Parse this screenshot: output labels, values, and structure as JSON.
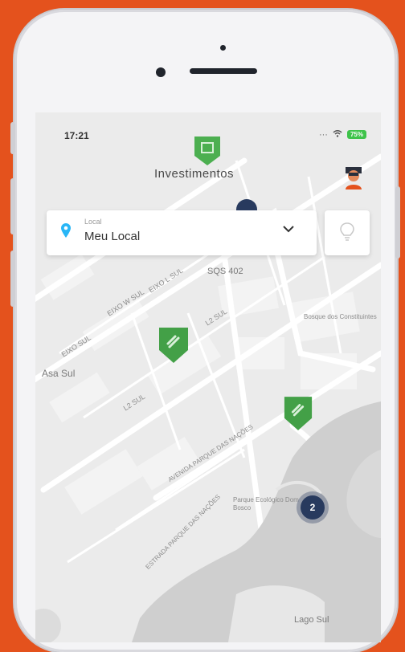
{
  "status_bar": {
    "time": "17:21",
    "battery": "75%"
  },
  "header": {
    "title": "Investimentos"
  },
  "location_card": {
    "caption": "Local",
    "value": "Meu Local"
  },
  "map": {
    "labels": {
      "sqs": "SQS 402",
      "asa_sul": "Asa Sul",
      "bosque": "Bosque dos Constituintes",
      "parque": "Parque Ecológico Dom Bosco",
      "lago_sul": "Lago Sul",
      "l2_sul": "L2 SUL",
      "l2_sul_b": "L2 SUL",
      "eixo_w": "EIXO W SUL",
      "eixo_sul": "EIXO SUL",
      "eixo_l": "EIXO L SUL",
      "avenida": "AVENIDA PARQUE DAS NAÇÕES",
      "estrada": "ESTRADA PARQUE DAS NAÇÕES"
    },
    "cluster_count": "2"
  },
  "colors": {
    "accent": "#4caf50",
    "background": "#e4521d",
    "cluster": "#283a5e",
    "pin": "#29b6f6"
  }
}
